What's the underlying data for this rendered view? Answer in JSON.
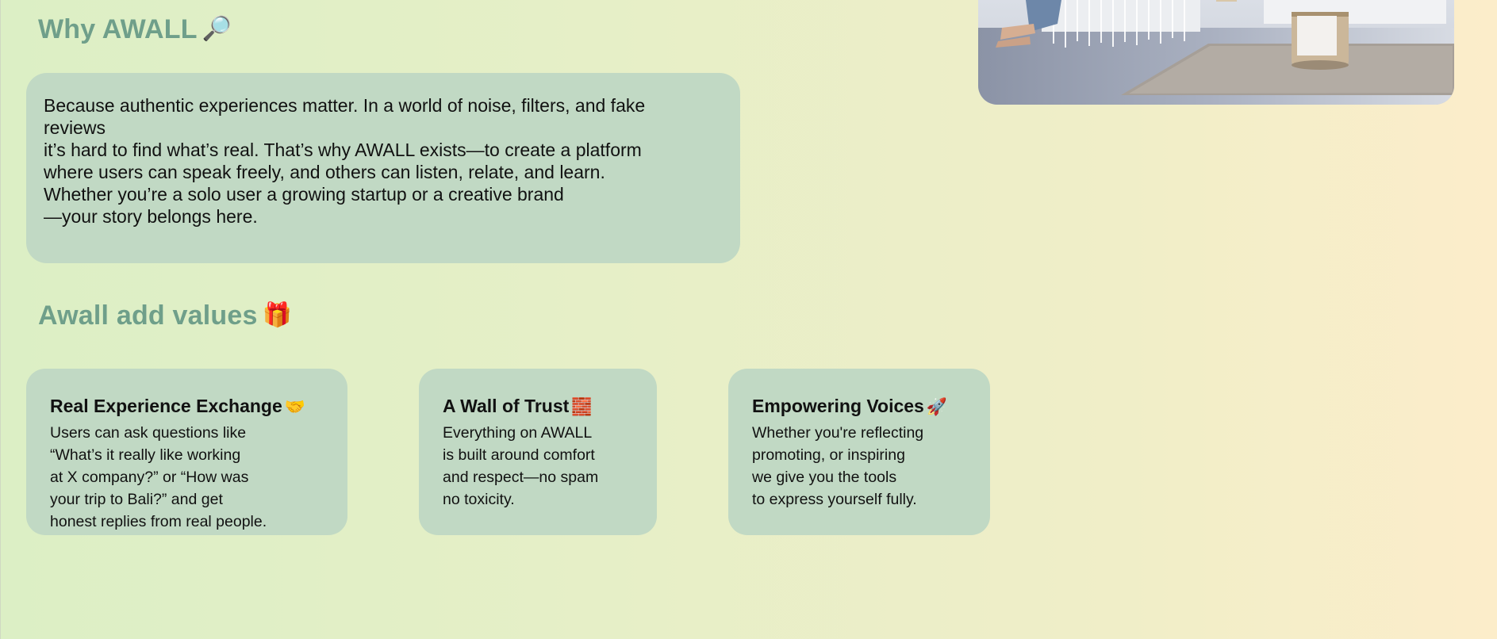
{
  "why": {
    "title": "Why AWALL",
    "icon": "🔎",
    "lines": [
      "Because authentic experiences matter. In a world of noise, filters, and fake",
      "reviews",
      "it’s hard to find what’s real. That’s why AWALL exists—to create a platform",
      "where users can speak freely, and others can listen, relate, and learn.",
      "Whether you’re a solo user a growing startup or a creative brand",
      "—your story belongs here."
    ]
  },
  "values": {
    "title": "Awall add values",
    "icon": "🎁",
    "cards": [
      {
        "title": "Real Experience Exchange",
        "icon": "🤝",
        "lines": [
          "Users can ask questions like",
          "“What’s it really like working",
          "at X company?” or “How was",
          "your trip to Bali?” and get",
          "honest replies from real people."
        ]
      },
      {
        "title": "A Wall of Trust",
        "icon": "🧱",
        "lines": [
          "Everything on AWALL",
          "is built around comfort",
          "and respect—no spam",
          "no toxicity."
        ]
      },
      {
        "title": "Empowering Voices",
        "icon": "🚀",
        "lines": [
          "Whether you're reflecting",
          "promoting, or inspiring",
          "we give you the tools",
          "to express yourself fully."
        ]
      }
    ]
  },
  "colors": {
    "heading": "#6f9f8a",
    "card_bg": "#c1d9c4",
    "bg_start": "#dcefc5",
    "bg_end": "#fcedca"
  }
}
